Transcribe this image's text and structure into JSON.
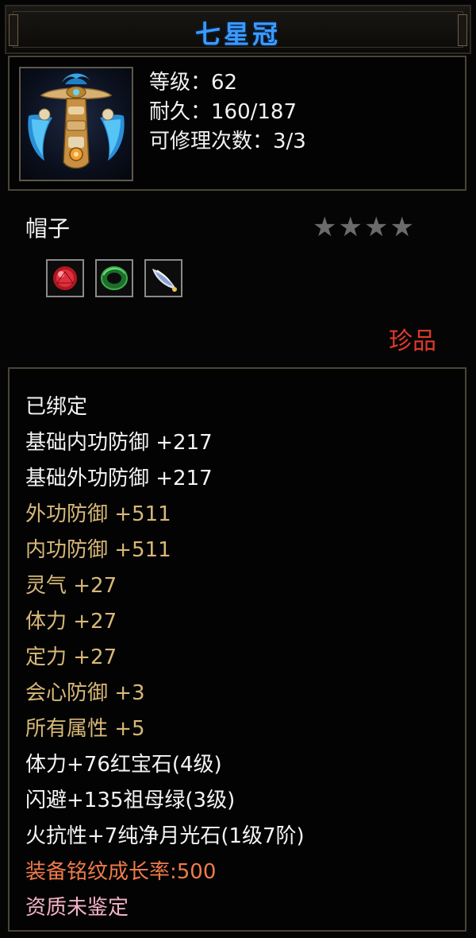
{
  "item": {
    "name": "七星冠",
    "stats": {
      "level": "等级：62",
      "durability": "耐久：160/187",
      "repairs": "可修理次数：3/3"
    },
    "type": "帽子",
    "stars": "★★★★",
    "star_count": 4,
    "quality": "珍品",
    "gem_slots": [
      {
        "name": "ruby",
        "color": "#c0202a"
      },
      {
        "name": "emerald",
        "color": "#2c9a3a"
      },
      {
        "name": "moonstone",
        "color": "#c8d4e8"
      }
    ]
  },
  "properties": [
    {
      "text": "已绑定",
      "color": "white"
    },
    {
      "text": "基础内功防御 +217",
      "color": "white"
    },
    {
      "text": "基础外功防御 +217",
      "color": "white"
    },
    {
      "text": "外功防御 +511",
      "color": "gold"
    },
    {
      "text": "内功防御 +511",
      "color": "gold"
    },
    {
      "text": "灵气 +27",
      "color": "gold"
    },
    {
      "text": "体力 +27",
      "color": "gold"
    },
    {
      "text": "定力 +27",
      "color": "gold"
    },
    {
      "text": "会心防御 +3",
      "color": "gold"
    },
    {
      "text": "所有属性 +5",
      "color": "gold"
    },
    {
      "text": "体力+76红宝石(4级)",
      "color": "white"
    },
    {
      "text": "闪避+135祖母绿(3级)",
      "color": "white"
    },
    {
      "text": "火抗性+7纯净月光石(1级7阶)",
      "color": "white"
    },
    {
      "text": "装备铭纹成长率:500",
      "color": "red"
    },
    {
      "text": "资质未鉴定",
      "color": "pink"
    }
  ],
  "colors": {
    "white": "#f4f4f4",
    "gold": "#d8b878",
    "red": "#f07a4a",
    "pink": "#f4b2c6",
    "title": "#3a9bff",
    "quality": "#e03a2a"
  }
}
